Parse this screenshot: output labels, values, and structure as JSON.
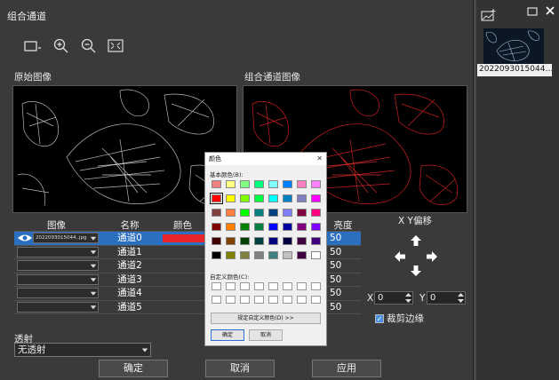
{
  "window": {
    "title": "组合通道"
  },
  "toolbar": {
    "icons": [
      "rect-select-icon",
      "zoom-in-icon",
      "zoom-out-icon",
      "fit-icon"
    ]
  },
  "panels": {
    "original_label": "原始图像",
    "composite_label": "组合通道图像"
  },
  "right_panel": {
    "thumbnail_label": "2022093015044…"
  },
  "table": {
    "headers": {
      "image": "图像",
      "name": "名称",
      "color": "颜色",
      "brightness": "亮度"
    },
    "rows": [
      {
        "file": "2022093015044..jpg",
        "name": "通道0",
        "brightness": "50",
        "color": "#e8252a",
        "selected": true
      },
      {
        "file": "",
        "name": "通道1",
        "brightness": "50"
      },
      {
        "file": "",
        "name": "通道2",
        "brightness": "50"
      },
      {
        "file": "",
        "name": "通道3",
        "brightness": "50"
      },
      {
        "file": "",
        "name": "通道4",
        "brightness": "50"
      },
      {
        "file": "",
        "name": "通道5",
        "brightness": "50"
      }
    ]
  },
  "offset": {
    "title": "X Y偏移",
    "x_label": "X",
    "x_value": "0",
    "y_label": "Y",
    "y_value": "0"
  },
  "crop": {
    "label": "裁剪边缘",
    "checked": true
  },
  "transmission": {
    "label": "透射",
    "value": "无透射"
  },
  "buttons": {
    "ok": "确定",
    "cancel": "取消",
    "apply": "应用"
  },
  "color_dialog": {
    "title": "颜色",
    "basic_label": "基本颜色(B):",
    "custom_label": "自定义颜色(C):",
    "define_button": "规定自定义颜色(D) >>",
    "ok_button": "确定",
    "cancel_button": "取消",
    "basic_colors": [
      "#f08080",
      "#ffff80",
      "#80ff80",
      "#00ff80",
      "#80ffff",
      "#0080ff",
      "#ff80c0",
      "#ff80ff",
      "#ff0000",
      "#ffff00",
      "#80ff00",
      "#00ff40",
      "#00ffff",
      "#0080c0",
      "#8080c0",
      "#ff00ff",
      "#804040",
      "#ff8040",
      "#00ff00",
      "#008080",
      "#004080",
      "#8080ff",
      "#800040",
      "#ff0080",
      "#800000",
      "#ff8000",
      "#008000",
      "#008040",
      "#0000ff",
      "#0000a0",
      "#800080",
      "#8000ff",
      "#400000",
      "#804000",
      "#004000",
      "#004040",
      "#000080",
      "#000040",
      "#400040",
      "#400080",
      "#000000",
      "#808000",
      "#808040",
      "#808080",
      "#408080",
      "#c0c0c0",
      "#400040",
      "#ffffff"
    ],
    "selected_index": 8
  }
}
